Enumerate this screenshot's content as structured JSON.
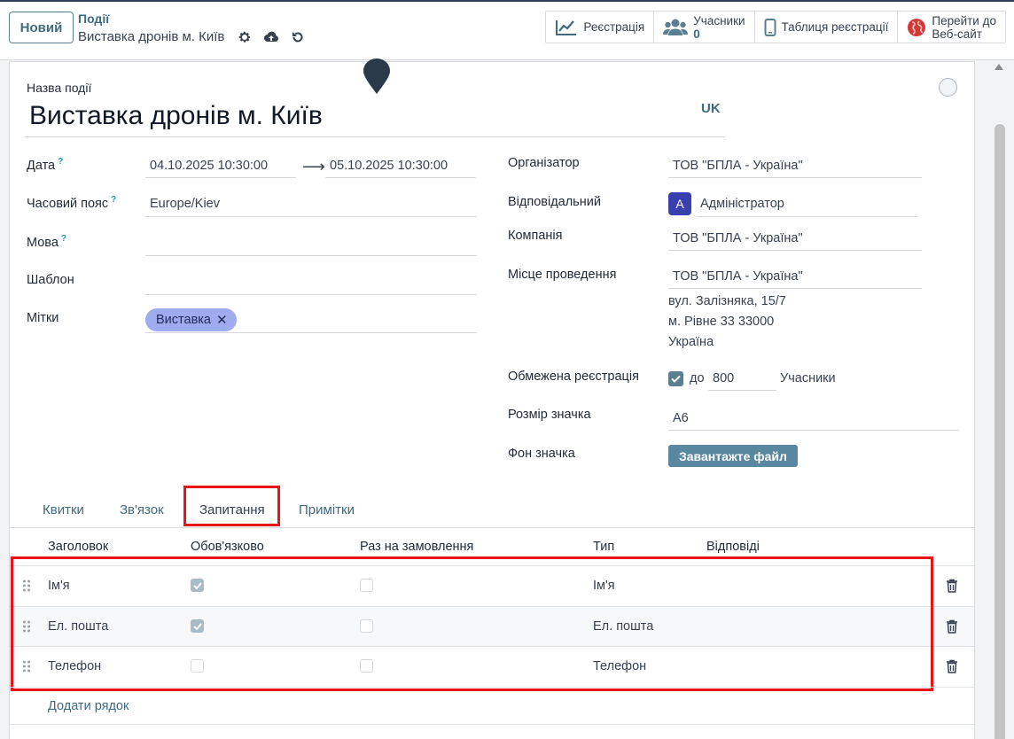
{
  "control": {
    "new_label": "Новий",
    "breadcrumb": "Події",
    "record_title": "Виставка дронів м. Київ"
  },
  "smart_buttons": {
    "registration": "Реєстрація",
    "attendees_label": "Учасники",
    "attendees_count": "0",
    "registration_desk": "Таблиця реєстрації",
    "website_line1": "Перейти до",
    "website_line2": "Веб-сайт"
  },
  "form": {
    "name_label": "Назва події",
    "name_value": "Виставка дронів м. Київ",
    "lang": "UK",
    "date_label": "Дата",
    "date_start": "04.10.2025 10:30:00",
    "date_end": "05.10.2025 10:30:00",
    "timezone_label": "Часовий пояс",
    "timezone_value": "Europe/Kiev",
    "language_label": "Мова",
    "language_value": "",
    "template_label": "Шаблон",
    "template_value": "",
    "tags_label": "Мітки",
    "tag": "Виставка",
    "help_mark": "?",
    "organizer_label": "Організатор",
    "organizer_value": "ТОВ \"БПЛА - Україна\"",
    "responsible_label": "Відповідальний",
    "responsible_avatar": "A",
    "responsible_value": "Адміністратор",
    "company_label": "Компанія",
    "company_value": "ТОВ \"БПЛА - Україна\"",
    "venue_label": "Місце проведення",
    "venue_value": "ТОВ \"БПЛА - Україна\"",
    "venue_street": "вул. Залізняка, 15/7",
    "venue_city": "м. Рівне 33 33000",
    "venue_country": "Україна",
    "limit_label": "Обмежена реєстрація",
    "limit_to": "до",
    "limit_value": "800",
    "limit_unit": "Учасники",
    "badge_size_label": "Розмір значка",
    "badge_size_value": "A6",
    "badge_bg_label": "Фон значка",
    "upload_label": "Завантажте файл"
  },
  "tabs": [
    "Квитки",
    "Зв'язок",
    "Запитання",
    "Примітки"
  ],
  "table": {
    "headers": [
      "Заголовок",
      "Обов'язково",
      "Раз на замовлення",
      "Тип",
      "Відповіді"
    ],
    "rows": [
      {
        "title": "Ім'я",
        "mandatory": true,
        "once_per_order": false,
        "type": "Ім'я",
        "answers": ""
      },
      {
        "title": "Ел. пошта",
        "mandatory": true,
        "once_per_order": false,
        "type": "Ел. пошта",
        "answers": ""
      },
      {
        "title": "Телефон",
        "mandatory": false,
        "once_per_order": false,
        "type": "Телефон",
        "answers": ""
      }
    ],
    "add_line": "Додати рядок"
  },
  "colors": {
    "brand": "#3f6a80",
    "highlight": "#e8141c",
    "tag_bg": "#9eabee",
    "avatar_bg": "#3a3fb0"
  }
}
